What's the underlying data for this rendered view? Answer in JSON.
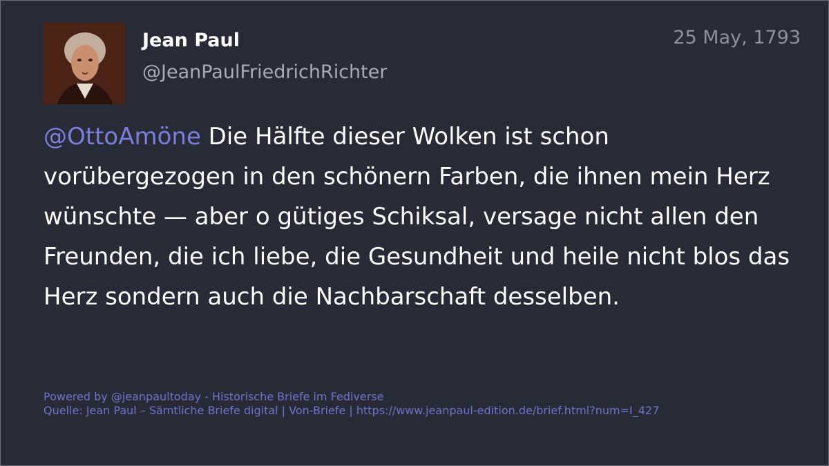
{
  "post": {
    "author_name": "Jean Paul",
    "author_handle": "@JeanPaulFriedrichRichter",
    "date": "25 May, 1793",
    "avatar_icon": "portrait-avatar",
    "mention": "@OttoAmöne",
    "text": " Die Hälfte dieser Wolken ist schon vorübergezogen in den schönern Farben, die ihnen mein Herz wünschte — aber o gütiges Schiksal, versage nicht allen den Freunden, die ich liebe, die Gesundheit und heile nicht blos das Herz sondern auch die Nachbarschaft desselben."
  },
  "footer": {
    "powered_by": "Powered by @jeanpaultoday - Historische Briefe im Fediverse",
    "source": "Quelle: Jean Paul – Sämtliche Briefe digital | Von-Briefe | https://www.jeanpaul-edition.de/brief.html?num=I_427"
  },
  "colors": {
    "background": "#282a36",
    "mention": "#7b7fdb",
    "footer": "#7073c8",
    "handle": "#a9abb3",
    "date": "#8f9099"
  }
}
